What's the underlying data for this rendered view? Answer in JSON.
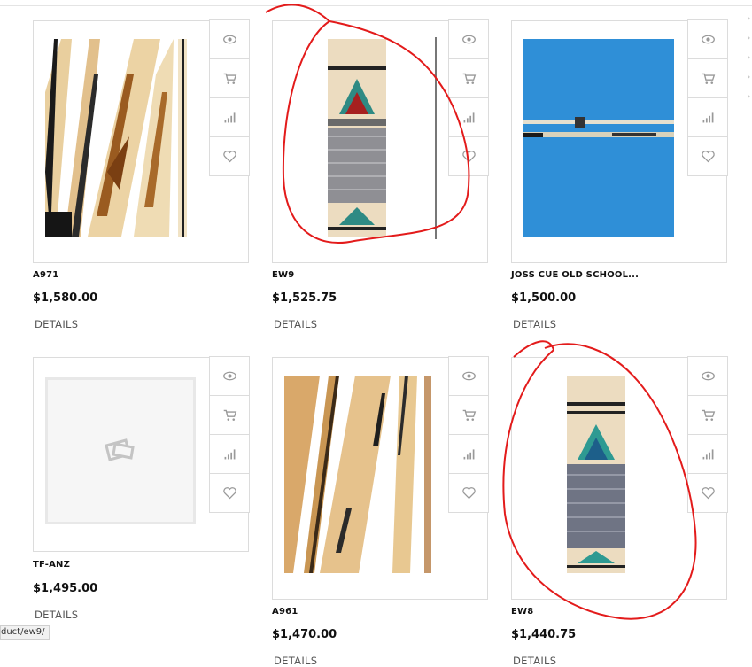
{
  "products": [
    {
      "name": "A971",
      "price": "$1,580.00",
      "details": "DETAILS",
      "image": "maple-cue-ebony-points"
    },
    {
      "name": "EW9",
      "price": "$1,525.75",
      "details": "DETAILS",
      "image": "cue-butt-diamond-inlay"
    },
    {
      "name": "JOSS CUE OLD SCHOOL...",
      "price": "$1,500.00",
      "details": "DETAILS",
      "image": "two-cues-on-blue-cloth"
    },
    {
      "name": "TF-ANZ",
      "price": "$1,495.00",
      "details": "DETAILS",
      "image": "placeholder-image"
    },
    {
      "name": "A961",
      "price": "$1,470.00",
      "details": "DETAILS",
      "image": "birdseye-maple-cue"
    },
    {
      "name": "EW8",
      "price": "$1,440.75",
      "details": "DETAILS",
      "image": "cue-butt-teal-inlay"
    }
  ],
  "actions": [
    "quick-view-icon",
    "cart-icon",
    "compare-icon",
    "heart-icon"
  ],
  "status_url": "duct/ew9/",
  "annotations": {
    "color": "#e31b1b",
    "note": "red hand-drawn circles around EW9 and EW8"
  }
}
